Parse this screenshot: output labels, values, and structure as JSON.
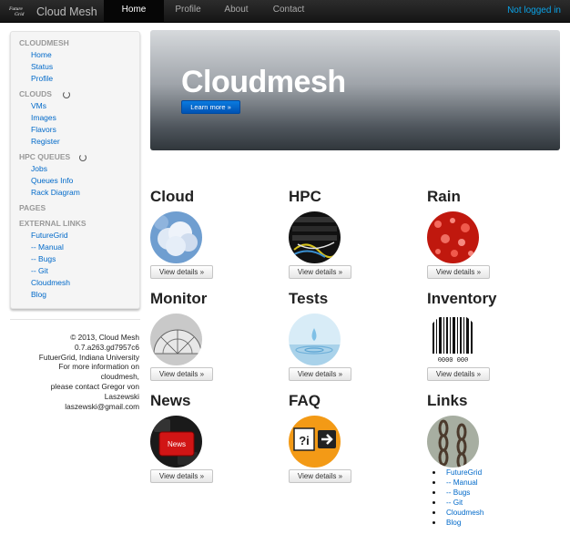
{
  "navbar": {
    "logo_line1": "Future",
    "logo_line2": "Grid",
    "brand": "Cloud Mesh",
    "items": [
      "Home",
      "Profile",
      "About",
      "Contact"
    ],
    "login": "Not logged in"
  },
  "sidebar": {
    "cloudmesh_header": "CLOUDMESH",
    "cloudmesh_items": [
      "Home",
      "Status",
      "Profile"
    ],
    "clouds_header": "CLOUDS",
    "clouds_items": [
      "VMs",
      "Images",
      "Flavors",
      "Register"
    ],
    "hpc_header": "HPC QUEUES",
    "hpc_items": [
      "Jobs",
      "Queues Info",
      "Rack Diagram"
    ],
    "pages_header": "PAGES",
    "external_header": "EXTERNAL LINKS",
    "external_items": [
      "FutureGrid",
      "-- Manual",
      "-- Bugs",
      "-- Git",
      "Cloudmesh",
      "Blog"
    ]
  },
  "footer": {
    "lines": [
      "© 2013, Cloud Mesh",
      "0.7.a263.gd7957c6",
      "FutuerGrid, Indiana University",
      "For more information on",
      "cloudmesh,",
      "please contact Gregor von",
      "Laszewski",
      "laszewski@gmail.com"
    ]
  },
  "hero": {
    "title": "Cloudmesh",
    "button": "Learn more »"
  },
  "tiles": {
    "cloud": {
      "title": "Cloud",
      "button": "View details »"
    },
    "hpc": {
      "title": "HPC",
      "button": "View details »"
    },
    "rain": {
      "title": "Rain",
      "button": "View details »"
    },
    "monitor": {
      "title": "Monitor",
      "button": "View details »"
    },
    "tests": {
      "title": "Tests",
      "button": "View details »"
    },
    "inventory": {
      "title": "Inventory",
      "button": "View details »",
      "barcode_text": "0000 000"
    },
    "news": {
      "title": "News",
      "button": "View details »",
      "key_text": "News"
    },
    "faq": {
      "title": "FAQ",
      "button": "View details »",
      "sign_text": "?i"
    },
    "links": {
      "title": "Links",
      "items": [
        "FutureGrid",
        "-- Manual",
        "-- Bugs",
        "-- Git",
        "Cloudmesh",
        "Blog"
      ]
    }
  },
  "colors": {
    "navbar": "#1b1b1b",
    "link": "#0069c9",
    "login": "#0ba2e6",
    "hero_button": "#0069d0"
  }
}
